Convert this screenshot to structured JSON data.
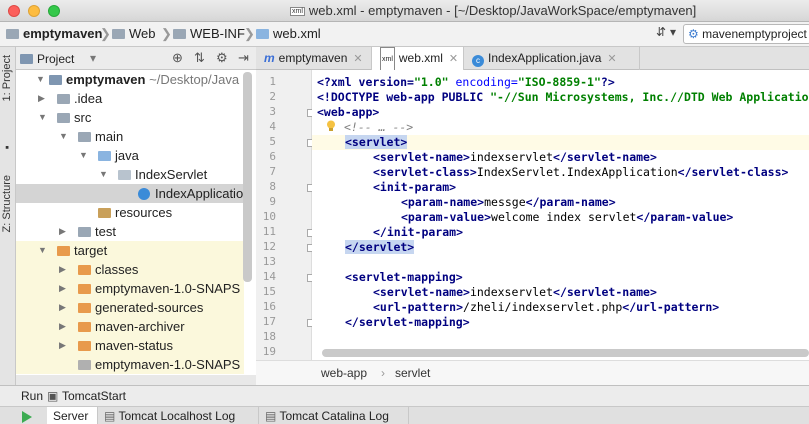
{
  "window": {
    "title": "web.xml - emptymaven - [~/Desktop/JavaWorkSpace/emptymaven]",
    "file_badge": "xml"
  },
  "navbar": {
    "crumbs": [
      "emptymaven",
      "Web",
      "WEB-INF",
      "web.xml"
    ],
    "run_config": "mavenemptyproject"
  },
  "sidebar_tabs": {
    "project": "1: Project",
    "structure": "Z: Structure"
  },
  "project_panel": {
    "title": "Project",
    "tree": [
      {
        "label": "emptymaven",
        "suffix": "~/Desktop/Java",
        "bold": true
      },
      {
        "label": ".idea"
      },
      {
        "label": "src"
      },
      {
        "label": "main"
      },
      {
        "label": "java"
      },
      {
        "label": "IndexServlet"
      },
      {
        "label": "IndexApplicatio"
      },
      {
        "label": "resources"
      },
      {
        "label": "test"
      },
      {
        "label": "target"
      },
      {
        "label": "classes"
      },
      {
        "label": "emptymaven-1.0-SNAPS"
      },
      {
        "label": "generated-sources"
      },
      {
        "label": "maven-archiver"
      },
      {
        "label": "maven-status"
      },
      {
        "label": "emptymaven-1.0-SNAPS"
      }
    ]
  },
  "editor": {
    "tabs": [
      {
        "label": "emptymaven",
        "icon": "maven-icon"
      },
      {
        "label": "web.xml",
        "icon": "xml-file-icon"
      },
      {
        "label": "IndexApplication.java",
        "icon": "java-class-icon"
      }
    ],
    "line_numbers": [
      "1",
      "2",
      "3",
      "4",
      "5",
      "6",
      "7",
      "8",
      "9",
      "10",
      "11",
      "12",
      "13",
      "14",
      "15",
      "16",
      "17",
      "18",
      "19"
    ],
    "lines": {
      "l1_a": "<?xml version=",
      "l1_b": "\"1.0\"",
      "l1_c": " encoding=",
      "l1_d": "\"ISO-8859-1\"",
      "l1_e": "?>",
      "l2_a": "<!DOCTYPE web-app PUBLIC ",
      "l2_b": "\"-//Sun Microsystems, Inc.//DTD Web Applicatio",
      "l3": "<web-app>",
      "l4": "<!-- … -->",
      "l5": "<servlet>",
      "l6_open": "<servlet-name>",
      "l6_text": "indexservlet",
      "l6_close": "</servlet-name>",
      "l7_open": "<servlet-class>",
      "l7_text": "IndexServlet.IndexApplication",
      "l7_close": "</servlet-class>",
      "l8": "<init-param>",
      "l9_open": "<param-name>",
      "l9_text": "messge",
      "l9_close": "</param-name>",
      "l10_open": "<param-value>",
      "l10_text": "welcome index servlet",
      "l10_close": "</param-value>",
      "l11": "</init-param>",
      "l12": "</servlet>",
      "l14": "<servlet-mapping>",
      "l15_open": "<servlet-name>",
      "l15_text": "indexservlet",
      "l15_close": "</servlet-name>",
      "l16_open": "<url-pattern>",
      "l16_text": "/zheli/indexservlet.php",
      "l16_close": "</url-pattern>",
      "l17": "</servlet-mapping>"
    },
    "breadcrumb": [
      "web-app",
      "servlet"
    ]
  },
  "run_panel": {
    "label": "Run",
    "config": "TomcatStart",
    "tabs": [
      "Server",
      "Tomcat Localhost Log",
      "Tomcat Catalina Log"
    ]
  },
  "colors": {
    "tag": "#000080",
    "string": "#008000",
    "comment": "#808080",
    "selection": "#d4d4d4",
    "tag_highlight": "#c6d6f0",
    "run_green": "#3cab52"
  }
}
